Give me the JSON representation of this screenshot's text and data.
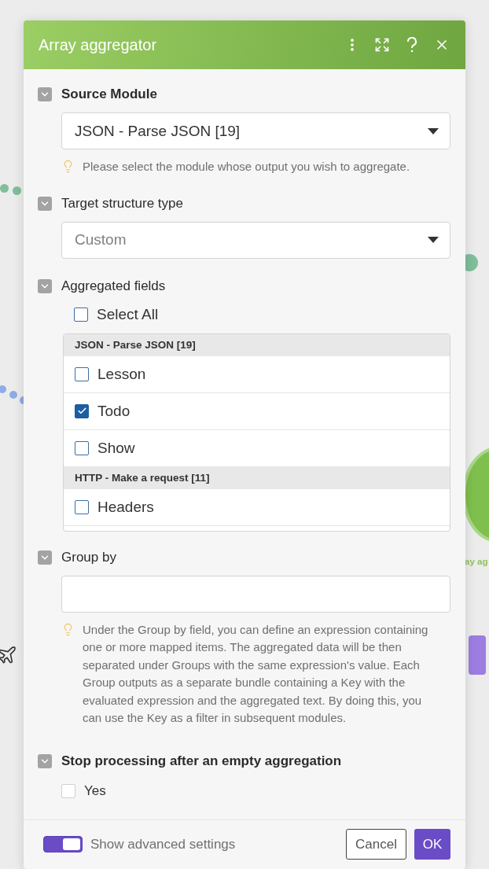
{
  "canvas": {
    "module_label": "ay ag"
  },
  "dialog": {
    "title": "Array aggregator"
  },
  "sections": [
    {
      "kind": "select",
      "label": "Source Module",
      "required": true,
      "value": "JSON - Parse JSON [19]",
      "muted": false,
      "hint": "Please select the module whose output you wish to aggregate."
    },
    {
      "kind": "select",
      "label": "Target structure type",
      "required": false,
      "value": "Custom",
      "muted": true
    },
    {
      "kind": "fields",
      "label": "Aggregated fields",
      "required": false,
      "select_all": {
        "label": "Select All",
        "checked": false
      },
      "groups": [
        {
          "title": "JSON - Parse JSON [19]",
          "items": [
            {
              "label": "Lesson",
              "checked": false
            },
            {
              "label": "Todo",
              "checked": true
            },
            {
              "label": "Show",
              "checked": false
            }
          ]
        },
        {
          "title": "HTTP - Make a request [11]",
          "items": [
            {
              "label": "Headers",
              "checked": false
            }
          ]
        }
      ]
    },
    {
      "kind": "input",
      "label": "Group by",
      "required": false,
      "hint": "Under the Group by field, you can define an expression containing one or more mapped items. The aggregated data will be then separated under Groups with the same expression's value. Each Group outputs as a separate bundle containing a Key with the evaluated expression and the aggregated text. By doing this, you can use the Key as a filter in subsequent modules."
    },
    {
      "kind": "checkbox",
      "label": "Stop processing after an empty aggregation",
      "required": true,
      "option": {
        "label": "Yes",
        "checked": false
      }
    }
  ],
  "footer": {
    "advanced": {
      "label": "Show advanced settings",
      "on": true
    },
    "cancel": "Cancel",
    "ok": "OK"
  }
}
